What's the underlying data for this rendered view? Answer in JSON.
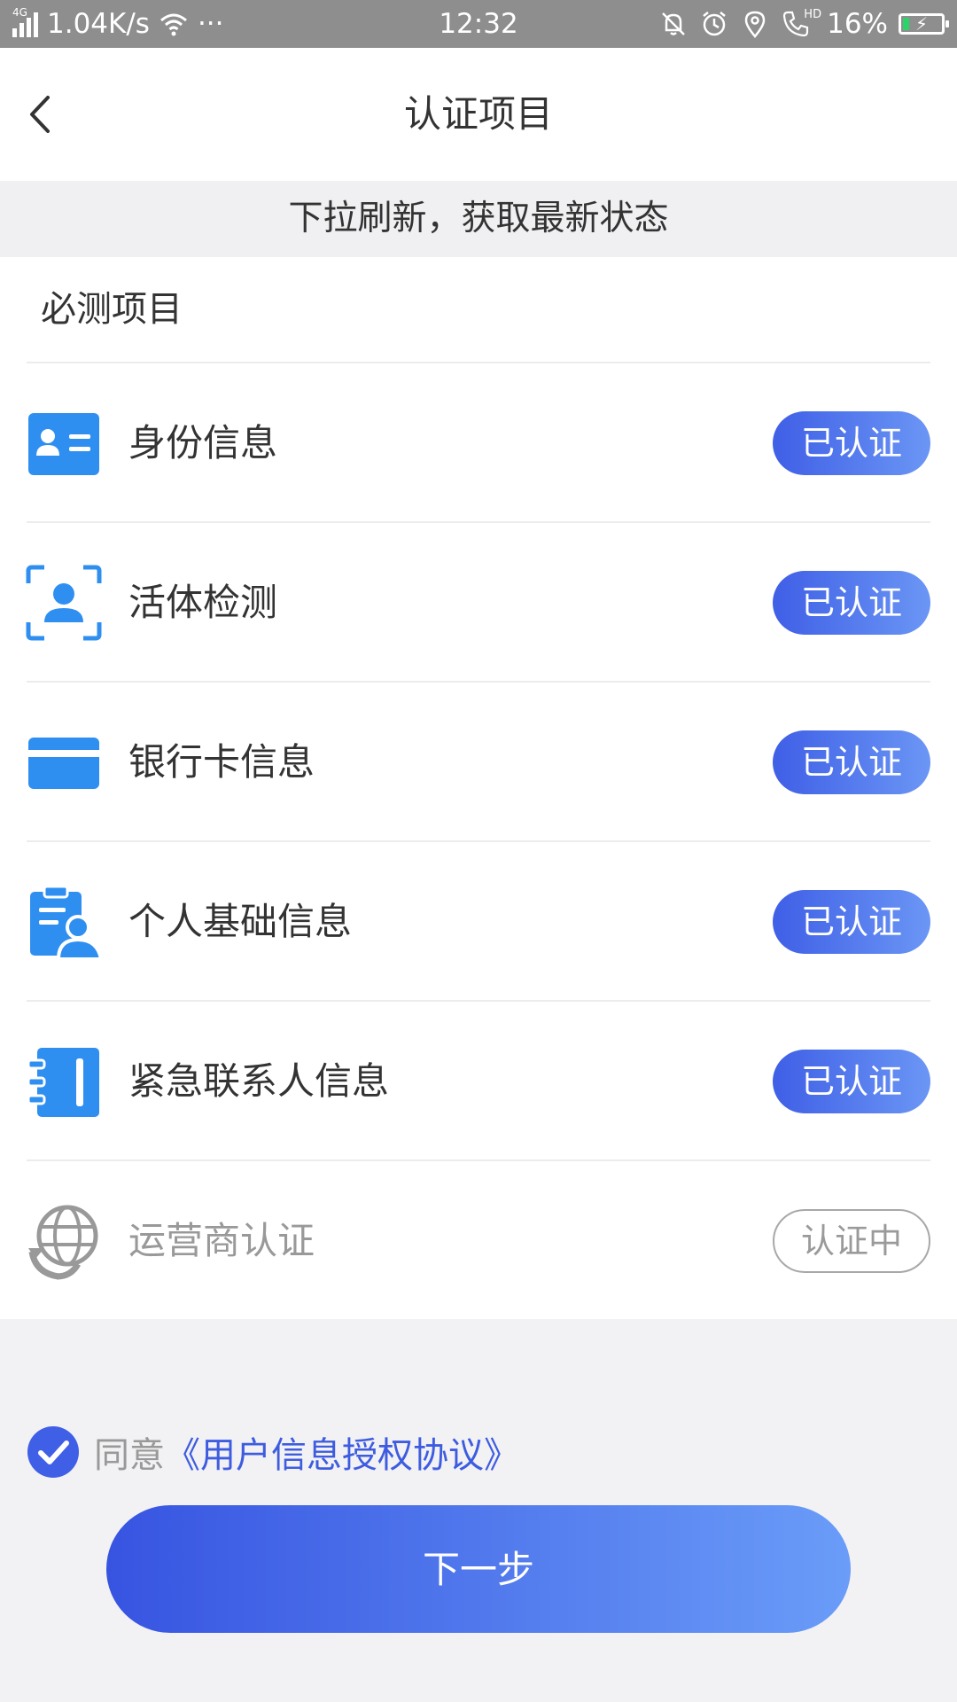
{
  "status_bar": {
    "network": "4G",
    "speed": "1.04K/s",
    "more": "···",
    "time": "12:32",
    "hd": "HD",
    "battery_percent_text": "16%",
    "battery_level": 0.16
  },
  "nav": {
    "title": "认证项目"
  },
  "hint": "下拉刷新，获取最新状态",
  "section": {
    "title": "必测项目",
    "items": [
      {
        "label": "身份信息",
        "status": "已认证",
        "icon": "id-card-icon"
      },
      {
        "label": "活体检测",
        "status": "已认证",
        "icon": "face-scan-icon"
      },
      {
        "label": "银行卡信息",
        "status": "已认证",
        "icon": "bank-card-icon"
      },
      {
        "label": "个人基础信息",
        "status": "已认证",
        "icon": "personal-info-icon"
      },
      {
        "label": "紧急联系人信息",
        "status": "已认证",
        "icon": "contacts-book-icon"
      },
      {
        "label": "运营商认证",
        "status": "认证中",
        "icon": "carrier-globe-icon"
      }
    ]
  },
  "agreement": {
    "prefix": "同意",
    "link": "《用户信息授权协议》",
    "checked": true
  },
  "next_button": {
    "label": "下一步"
  },
  "colors": {
    "accent": "#3f5fe6",
    "accent_light": "#6b96f5",
    "icon_blue": "#2f8ff0",
    "muted": "#999999"
  }
}
